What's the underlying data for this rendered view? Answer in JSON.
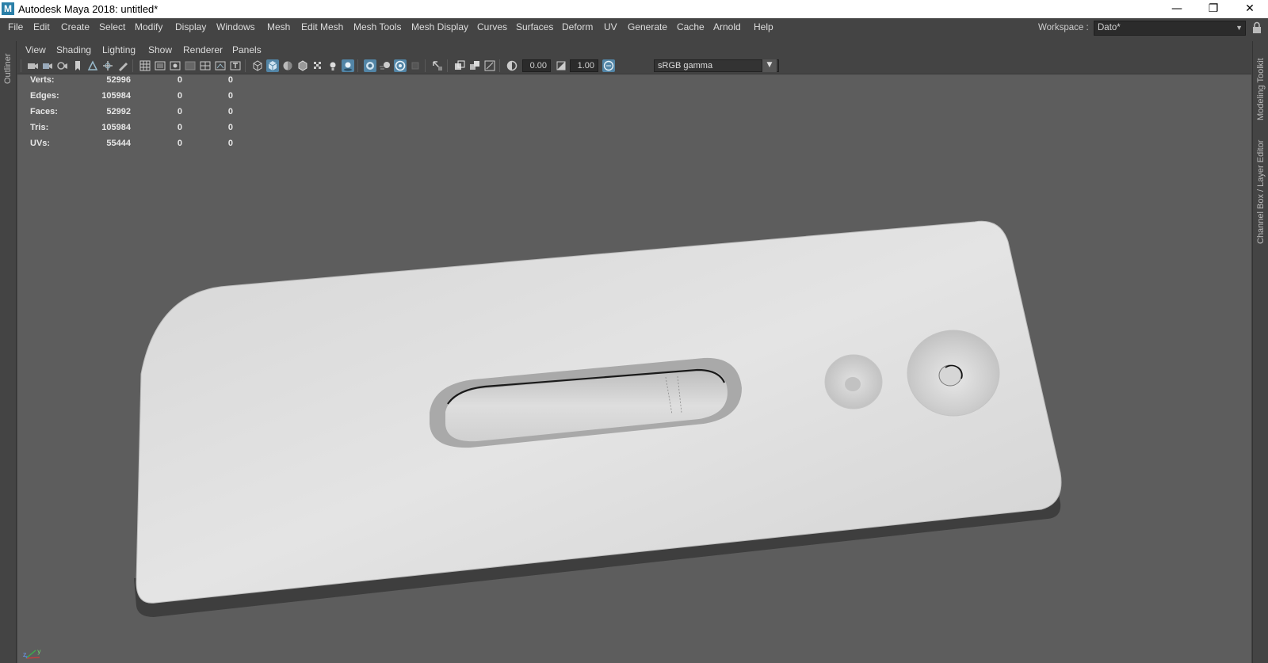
{
  "window": {
    "title": "Autodesk Maya 2018: untitled*",
    "app_icon_letter": "M",
    "minimize": "—",
    "restore": "❐",
    "close": "✕"
  },
  "menu": {
    "items": [
      "File",
      "Edit",
      "Create",
      "Select",
      "Modify",
      "Display",
      "Windows",
      "Mesh",
      "Edit Mesh",
      "Mesh Tools",
      "Mesh Display",
      "Curves",
      "Surfaces",
      "Deform",
      "UV",
      "Generate",
      "Cache",
      "Arnold",
      "Help"
    ],
    "workspace_label": "Workspace :",
    "workspace_value": "Dato*"
  },
  "side_tabs": {
    "left": "Outliner",
    "right_top": "Modeling Toolkit",
    "right_bottom": "Channel Box / Layer Editor"
  },
  "panel_menu": [
    "View",
    "Shading",
    "Lighting",
    "Show",
    "Renderer",
    "Panels"
  ],
  "toolbar": {
    "exposure": "0.00",
    "gamma": "1.00",
    "color_space": "sRGB gamma"
  },
  "hud": {
    "rows": [
      {
        "label": "Verts:",
        "v1": "52996",
        "v2": "0",
        "v3": "0"
      },
      {
        "label": "Edges:",
        "v1": "105984",
        "v2": "0",
        "v3": "0"
      },
      {
        "label": "Faces:",
        "v1": "52992",
        "v2": "0",
        "v3": "0"
      },
      {
        "label": "Tris:",
        "v1": "105984",
        "v2": "0",
        "v3": "0"
      },
      {
        "label": "UVs:",
        "v1": "55444",
        "v2": "0",
        "v3": "0"
      }
    ]
  },
  "axis": {
    "x": "x",
    "y": "y",
    "z": "z"
  },
  "colors": {
    "ui_bg": "#444444",
    "viewport_bg": "#5d5d5d",
    "active_blue": "#5285a6",
    "model_face": "#dcdcdc",
    "model_side": "#3a3a3a"
  }
}
